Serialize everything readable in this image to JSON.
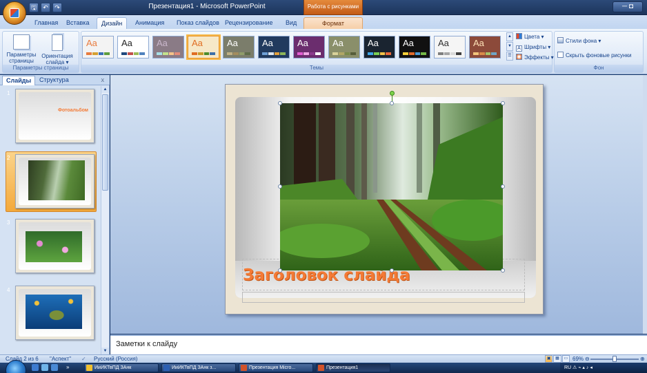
{
  "window": {
    "title": "Презентация1 - Microsoft PowerPoint",
    "context_tab_group": "Работа с рисунками",
    "controls": "─ ◘"
  },
  "quick_access": [
    "🖫",
    "↶",
    "↷"
  ],
  "tabs": [
    "Главная",
    "Вставка",
    "Дизайн",
    "Анимация",
    "Показ слайдов",
    "Рецензирование",
    "Вид",
    "Формат"
  ],
  "active_tab": "Дизайн",
  "ribbon": {
    "page_setup": {
      "label": "Параметры страницы",
      "params_btn": "Параметры страницы",
      "orient_btn": "Ориентация слайда ▾"
    },
    "themes": {
      "label": "Темы",
      "sample_text": "Aa",
      "items": [
        {
          "bg": "#f3f3f3",
          "fg": "#e87b3e",
          "bars": [
            "#e87b3e",
            "#d5a030",
            "#3b6fb6",
            "#5e9e3f"
          ]
        },
        {
          "bg": "#ffffff",
          "fg": "#222222",
          "bars": [
            "#1f497d",
            "#c0504d",
            "#9bbb59",
            "#4f81bd"
          ]
        },
        {
          "bg": "#8a7b86",
          "fg": "#c9b7cc",
          "bars": [
            "#a7e0e8",
            "#c4e28b",
            "#f5c48a",
            "#e28c7b"
          ]
        },
        {
          "bg": "#f6e8c8",
          "fg": "#e06d22",
          "bars": [
            "#e06d22",
            "#c89a2c",
            "#4c8b2b",
            "#3d6fa8"
          ]
        },
        {
          "bg": "#7b7d6b",
          "fg": "#ffffff",
          "bars": [
            "#c0b085",
            "#a38c5e",
            "#8f9d6a",
            "#5f6d4a"
          ]
        },
        {
          "bg": "#213a5e",
          "fg": "#ffffff",
          "bars": [
            "#6fa0d6",
            "#dce6f2",
            "#e3a03b",
            "#8fb759"
          ]
        },
        {
          "bg": "#6b2d6e",
          "fg": "#ffffff",
          "bars": [
            "#e35ed3",
            "#f0a7e6",
            "#8b3b8e",
            "#ffffff"
          ]
        },
        {
          "bg": "#8a8f6a",
          "fg": "#ffffff",
          "bars": [
            "#d9d29a",
            "#b1a766",
            "#7a8a4b",
            "#565d3a"
          ]
        },
        {
          "bg": "#1a2430",
          "fg": "#ffffff",
          "bars": [
            "#3ea6e8",
            "#7ad053",
            "#f3c34a",
            "#ea6a3b"
          ]
        },
        {
          "bg": "#111111",
          "fg": "#ffffff",
          "bars": [
            "#f5d03a",
            "#e06b2d",
            "#4c9bd6",
            "#75b948"
          ]
        },
        {
          "bg": "#f5f5f5",
          "fg": "#2e2e2e",
          "bars": [
            "#7f7f7f",
            "#a5a5a5",
            "#d9d9d9",
            "#3f3f3f"
          ]
        },
        {
          "bg": "#8c4a3a",
          "fg": "#ffe3b8",
          "bars": [
            "#f2c57c",
            "#d98b4a",
            "#a7c36a",
            "#6fa5c6"
          ]
        }
      ]
    },
    "colors_btn": "Цвета ▾",
    "fonts_btn": "Шрифты ▾",
    "effects_btn": "Эффекты ▾",
    "background": {
      "label": "Фон",
      "styles_btn": "Стили фона ▾",
      "hide_bg": "Скрыть фоновые рисунки"
    }
  },
  "left_panel": {
    "tab_slides": "Слайды",
    "tab_outline": "Структура",
    "close": "x",
    "slides": [
      {
        "num": "1",
        "caption": "Фотоальбом",
        "selected": false
      },
      {
        "num": "2",
        "selected": true
      },
      {
        "num": "3",
        "selected": false
      },
      {
        "num": "4",
        "selected": false
      }
    ]
  },
  "slide": {
    "title": "Заголовок слайда"
  },
  "notes": {
    "text": "Заметки к слайду"
  },
  "status": {
    "slide": "Слайд 2 из 6",
    "theme": "\"Аспект\"",
    "lang": "Русский (Россия)",
    "zoom": "69%",
    "zoom_level": 0.5
  },
  "taskbar": {
    "items": [
      "ИиИКТвПД ЗАнк",
      "ИиИКТвПД ЗАнк з...",
      "Презентация Micro...",
      "Презентация1"
    ],
    "tray": "RU  ⚠  ⌁  ▴  ♪ ◂"
  }
}
